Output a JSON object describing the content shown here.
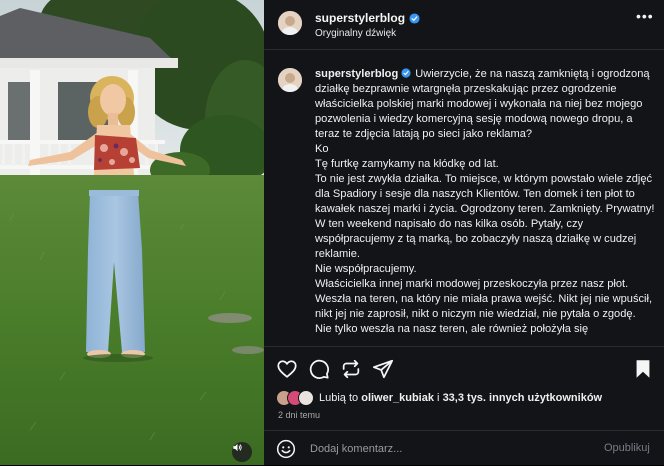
{
  "post": {
    "username": "superstylerblog",
    "audio_label": "Oryginalny dźwięk",
    "more_label": "•••",
    "verified_icon": "verified-badge-icon",
    "caption_lines": [
      "Uwierzycie, że na naszą zamkniętą i ogrodzoną działkę bezprawnie wtargnęła przeskakując przez ogrodzenie właścicielka polskiej marki modowej i wykonała na niej bez mojego pozwolenia i wiedzy komercyjną sesję modową nowego dropu, a teraz te zdjęcia latają po sieci jako reklama?",
      "Ko",
      "Tę furtkę zamykamy na kłódkę od lat.",
      "To nie jest zwykła działka. To miejsce, w którym powstało wiele zdjęć dla Spadiory i sesje dla naszych Klientów. Ten domek i ten płot to kawałek naszej marki i życia. Ogrodzony teren. Zamknięty. Prywatny!",
      "W ten weekend napisało do nas kilka osób. Pytały, czy współpracujemy z tą marką, bo zobaczyły naszą działkę w cudzej reklamie.",
      "Nie współpracujemy.",
      "Właścicielka innej marki modowej przeskoczyła przez nasz płot. Weszła na teren, na który nie miała prawa wejść. Nikt jej nie wpuścił, nikt jej nie zaprosił, nikt o niczym nie wiedział, nie pytała o zgodę. Nie tylko weszła na nasz teren, ale również położyła się"
    ],
    "likes_prefix": "Lubią to",
    "likes_user": "oliwer_kubiak",
    "likes_connector": "i",
    "likes_others": "33,3 tys. innych użytkowników",
    "time_ago": "2 dni temu",
    "comment_placeholder": "Dodaj komentarz...",
    "publish_label": "Opublikuj"
  },
  "colors": {
    "panel_bg": "#131418",
    "verified": "#3897f0",
    "text": "#f5f5f5",
    "muted": "#a8a8a8"
  }
}
